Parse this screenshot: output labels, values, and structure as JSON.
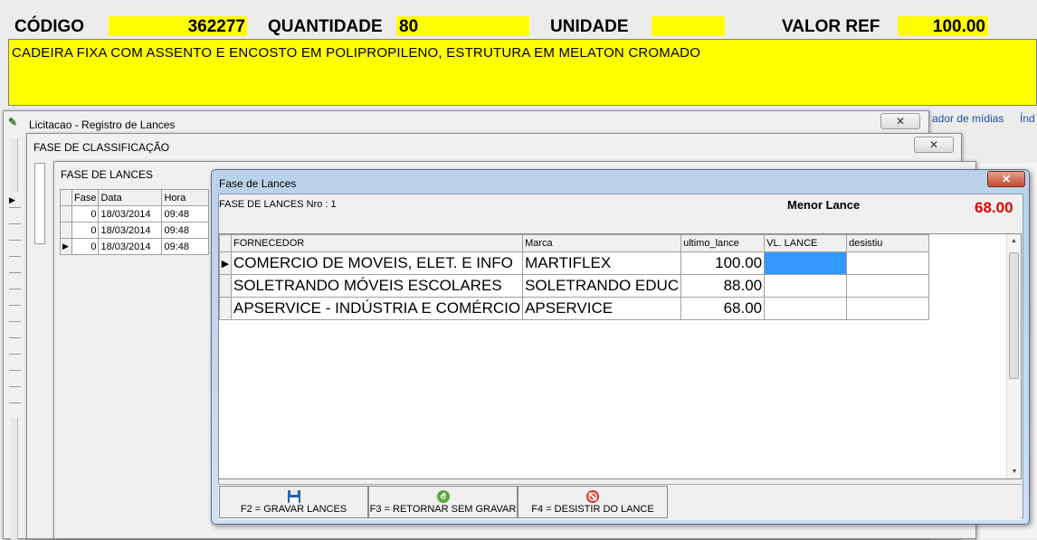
{
  "header": {
    "codigo_label": "CÓDIGO",
    "codigo_value": "362277",
    "quantidade_label": "QUANTIDADE",
    "quantidade_value": "80",
    "unidade_label": "UNIDADE",
    "unidade_value": "",
    "valor_ref_label": "VALOR REF",
    "valor_ref_value": "100.00",
    "description": "CADEIRA FIXA COM ASSENTO E ENCOSTO EM POLIPROPILENO, ESTRUTURA EM MELATON CROMADO"
  },
  "background_links": {
    "midias": "ador de mídias",
    "ind": "Índ"
  },
  "win_licitacao": {
    "title": "Licitacao - Registro de Lances",
    "close": "✕"
  },
  "win_classificacao": {
    "title": "FASE DE CLASSIFICAÇÃO",
    "close": "✕"
  },
  "win_lances_bg": {
    "title": "FASE DE LANCES",
    "columns": [
      "Fase",
      "Data",
      "Hora"
    ],
    "rows": [
      [
        "0",
        "18/03/2014",
        "09:48"
      ],
      [
        "0",
        "18/03/2014",
        "09:48"
      ],
      [
        "0",
        "18/03/2014",
        "09:48"
      ]
    ]
  },
  "dialog": {
    "title": "Fase de Lances",
    "close": "✕",
    "fase_nro": "FASE DE LANCES Nro : 1",
    "menor_lance_label": "Menor Lance",
    "menor_lance_value": "68.00",
    "columns": [
      "FORNECEDOR",
      "Marca",
      "ultimo_lance",
      "VL. LANCE",
      "desistiu"
    ],
    "rows": [
      {
        "fornecedor": "COMERCIO DE MOVEIS, ELET. E INFO",
        "marca": "MARTIFLEX",
        "ultimo_lance": "100.00",
        "vl_lance": "",
        "desistiu": ""
      },
      {
        "fornecedor": "SOLETRANDO MÓVEIS ESCOLARES",
        "marca": "SOLETRANDO EDUC",
        "ultimo_lance": "88.00",
        "vl_lance": "",
        "desistiu": ""
      },
      {
        "fornecedor": "APSERVICE - INDÚSTRIA E COMÉRCIO",
        "marca": "APSERVICE",
        "ultimo_lance": "68.00",
        "vl_lance": "",
        "desistiu": ""
      }
    ],
    "buttons": {
      "gravar": "F2 = GRAVAR LANCES",
      "retornar": "F3 = RETORNAR SEM GRAVAR",
      "desistir": "F4 = DESISTIR DO LANCE"
    }
  },
  "colors": {
    "highlight_yellow": "#ffff00",
    "menor_lance_red": "#e00000",
    "selected_cell": "#3399ff"
  }
}
